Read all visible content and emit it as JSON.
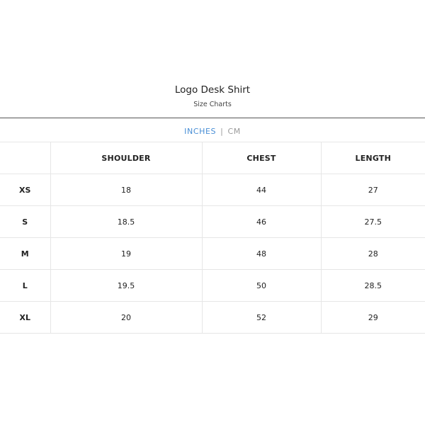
{
  "header": {
    "title": "Logo Desk Shirt",
    "subtitle": "Size Charts"
  },
  "units": {
    "inches": "INCHES",
    "separator": "|",
    "cm": "CM",
    "active": "INCHES",
    "active_color": "#4a8fd6",
    "inactive_color": "#9a9a9a"
  },
  "table": {
    "columns": [
      "",
      "SHOULDER",
      "CHEST",
      "LENGTH"
    ],
    "rows": [
      {
        "size": "XS",
        "shoulder": "18",
        "chest": "44",
        "length": "27"
      },
      {
        "size": "S",
        "shoulder": "18.5",
        "chest": "46",
        "length": "27.5"
      },
      {
        "size": "M",
        "shoulder": "19",
        "chest": "48",
        "length": "28"
      },
      {
        "size": "L",
        "shoulder": "19.5",
        "chest": "50",
        "length": "28.5"
      },
      {
        "size": "XL",
        "shoulder": "20",
        "chest": "52",
        "length": "29"
      }
    ]
  }
}
